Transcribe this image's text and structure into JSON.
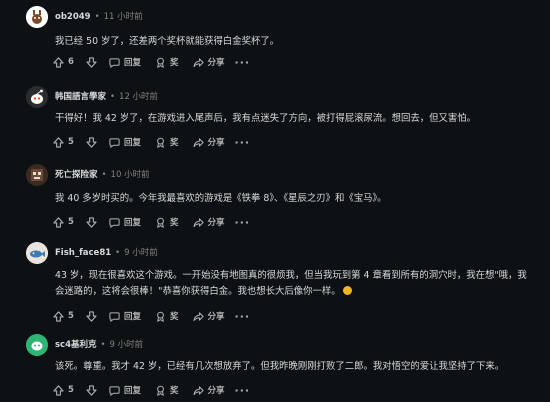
{
  "comments": [
    {
      "username": "ob2049",
      "time": "11 小时前",
      "body": "我已经 50 岁了，还差两个奖杯就能获得白金奖杯了。",
      "votes": "6",
      "reply_label": "回复",
      "award_label": "奖",
      "share_label": "分享",
      "more_label": "···"
    },
    {
      "username": "韩国語言學家",
      "time": "12 小时前",
      "body": "干得好！我 42 岁了，在游戏进入尾声后，我有点迷失了方向，被打得屁滚尿流。想回去，但又害怕。",
      "votes": "5",
      "reply_label": "回复",
      "award_label": "奖",
      "share_label": "分享",
      "more_label": "···"
    },
    {
      "username": "死亡探险家",
      "time": "10 小时前",
      "body": "我 40 多岁时买的。今年我最喜欢的游戏是《铁拳 8》、《星辰之刃》和《宝马》。",
      "votes": "5",
      "reply_label": "回复",
      "award_label": "奖",
      "share_label": "分享",
      "more_label": "···"
    },
    {
      "username": "Fish_face81",
      "time": "9 小时前",
      "body": "43 岁，现在很喜欢这个游戏。一开始没有地图真的很烦我，但当我玩到第 4 章看到所有的洞穴时，我在想\"哦，我会迷路的，这将会很棒！\"恭喜你获得白金。我也想长大后像你一样。",
      "votes": "5",
      "reply_label": "回复",
      "award_label": "奖",
      "share_label": "分享",
      "more_label": "···"
    },
    {
      "username": "sc4基利克",
      "time": "9 小时前",
      "body": "该死。尊重。我才 42 岁，已经有几次想放弃了。但我昨晚刚刚打败了二郎。我对悟空的爱让我坚持了下来。",
      "votes": "5",
      "reply_label": "回复",
      "award_label": "奖",
      "share_label": "分享",
      "more_label": "···"
    }
  ],
  "colors": {
    "background": "#0e1113",
    "text": "#d7dadc",
    "muted": "#818384",
    "thread_line": "#343536"
  },
  "icons": {
    "upvote": "arrow-up-icon",
    "downvote": "arrow-down-icon",
    "reply": "speech-bubble-icon",
    "award": "award-icon",
    "share": "share-arrow-icon",
    "more": "ellipsis-icon"
  }
}
